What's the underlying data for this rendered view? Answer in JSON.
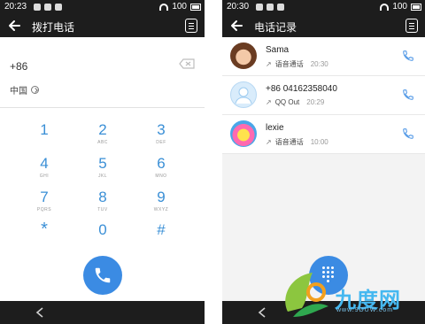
{
  "left": {
    "status": {
      "time": "20:23",
      "battery": "100"
    },
    "title": "拨打电话",
    "number": "+86",
    "region": "中国",
    "keys": [
      {
        "digit": "1",
        "letters": ""
      },
      {
        "digit": "2",
        "letters": "ABC"
      },
      {
        "digit": "3",
        "letters": "DEF"
      },
      {
        "digit": "4",
        "letters": "GHI"
      },
      {
        "digit": "5",
        "letters": "JKL"
      },
      {
        "digit": "6",
        "letters": "MNO"
      },
      {
        "digit": "7",
        "letters": "PQRS"
      },
      {
        "digit": "8",
        "letters": "TUV"
      },
      {
        "digit": "9",
        "letters": "WXYZ"
      },
      {
        "digit": "*",
        "letters": ""
      },
      {
        "digit": "0",
        "letters": ""
      },
      {
        "digit": "#",
        "letters": ""
      }
    ]
  },
  "right": {
    "status": {
      "time": "20:30",
      "battery": "100"
    },
    "title": "电话记录",
    "calls": [
      {
        "name": "Sama",
        "type": "语音通话",
        "time": "20:30"
      },
      {
        "name": "+86 04162358040",
        "type": "QQ Out",
        "time": "20:29"
      },
      {
        "name": "lexie",
        "type": "语音通话",
        "time": "10:00"
      }
    ]
  },
  "watermark": {
    "text": "九度网",
    "url": "www.9DUW.com"
  },
  "colors": {
    "accent": "#3b8be3",
    "keypad_digit": "#3a8fd6",
    "bar": "#1d1d1d"
  },
  "icons": [
    "back-arrow-icon",
    "dialpad-menu-icon",
    "backspace-icon",
    "chevron-right-icon",
    "phone-icon",
    "outgoing-call-icon",
    "dialpad-icon"
  ]
}
